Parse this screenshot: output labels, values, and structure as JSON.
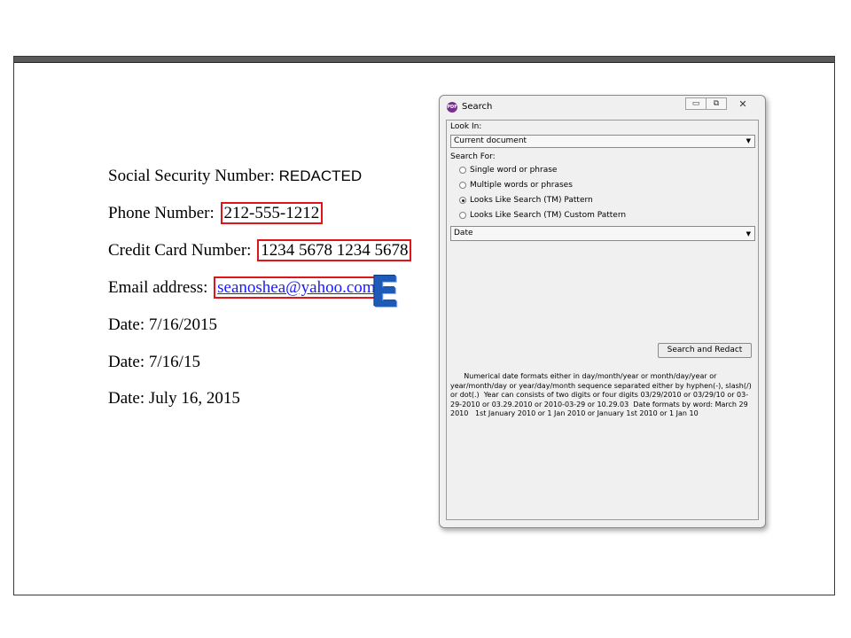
{
  "document": {
    "lines": [
      {
        "label": "Social Security Number: ",
        "value": "REDACTED"
      },
      {
        "label": "Phone Number: ",
        "value": "212-555-1212"
      },
      {
        "label": "Credit Card Number: ",
        "value": "1234 5678 1234 5678"
      },
      {
        "label": "Email address: ",
        "value": "seanoshea@yahoo.com"
      },
      {
        "label": "Date: 7/16/2015"
      },
      {
        "label": "Date: 7/16/15"
      },
      {
        "label": "Date: July 16, 2015"
      }
    ],
    "logo_letter": "E",
    "highlight_color": "#e0141b",
    "link_color": "#1a1aff"
  },
  "dialog": {
    "title": "Search",
    "app_icon": "PDF",
    "window_buttons": {
      "minimize": "▭",
      "restore": "⧉",
      "close": "✕"
    },
    "look_in_label": "Look In:",
    "look_in_value": "Current document",
    "search_for_label": "Search For:",
    "options": [
      {
        "label": "Single word or phrase",
        "selected": false
      },
      {
        "label": "Multiple words or phrases",
        "selected": false
      },
      {
        "label": "Looks Like Search (TM) Pattern",
        "selected": true
      },
      {
        "label": "Looks Like Search (TM) Custom Pattern",
        "selected": false
      }
    ],
    "pattern_value": "Date",
    "search_button": "Search and Redact",
    "description": "      Numerical date formats either in day/month/year or month/day/year or year/month/day or year/day/month sequence separated either by hyphen(-), slash(/) or dot(.)  Year can consists of two digits or four digits 03/29/2010 or 03/29/10 or 03-29-2010 or 03.29.2010 or 2010-03-29 or 10.29.03  Date formats by word: March 29 2010   1st January 2010 or 1 Jan 2010 or January 1st 2010 or 1 Jan 10"
  }
}
